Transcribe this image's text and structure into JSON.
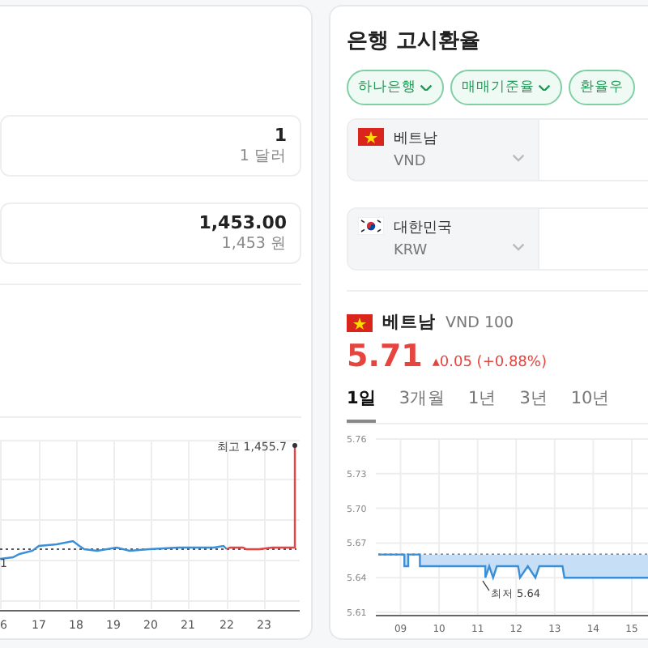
{
  "converter": {
    "rows": [
      {
        "value": "1",
        "unit": "1 달러"
      },
      {
        "value": "1,453.00",
        "unit": "1,453 원"
      }
    ],
    "chart": {
      "high_label": "최고 1,455.7",
      "low_label": "1",
      "x_labels": [
        "6",
        "17",
        "18",
        "19",
        "20",
        "21",
        "22",
        "23"
      ]
    }
  },
  "bank_rates": {
    "title": "은행 고시환율",
    "filters": [
      {
        "label": "하나은행",
        "chevron": true
      },
      {
        "label": "매매기준율",
        "chevron": true
      },
      {
        "label": "환율우",
        "chevron": false
      }
    ],
    "currencies": [
      {
        "kind": "vietnam",
        "country": "베트남",
        "code": "VND"
      },
      {
        "kind": "korea",
        "country": "대한민국",
        "code": "KRW"
      }
    ],
    "quote": {
      "country": "베트남",
      "unit": "VND 100",
      "price": "5.71",
      "change": "▴0.05 (+0.88%)"
    },
    "periods": [
      {
        "label": "1일",
        "selected": true
      },
      {
        "label": "3개월",
        "selected": false
      },
      {
        "label": "1년",
        "selected": false
      },
      {
        "label": "3년",
        "selected": false
      },
      {
        "label": "10년",
        "selected": false
      }
    ],
    "chart_data": {
      "type": "line",
      "grid": true,
      "xlim": [
        8.4,
        15.8
      ],
      "ylim": [
        5.61,
        5.76
      ],
      "xticks": [
        {
          "value": 9,
          "label": "09"
        },
        {
          "value": 10,
          "label": "10"
        },
        {
          "value": 11,
          "label": "11"
        },
        {
          "value": 12,
          "label": "12"
        },
        {
          "value": 13,
          "label": "13"
        },
        {
          "value": 14,
          "label": "14"
        },
        {
          "value": 15,
          "label": "15"
        }
      ],
      "yticks": [
        5.61,
        5.64,
        {
          "value": 5.67,
          "label": "5.67"
        },
        {
          "value": 5.7,
          "label": "5.70"
        },
        5.73,
        5.76
      ],
      "x": [
        8.42,
        9.1,
        9.1,
        9.2,
        9.2,
        9.5,
        9.5,
        11.2,
        11.2,
        11.3,
        11.4,
        11.5,
        12.05,
        12.1,
        12.3,
        12.5,
        12.6,
        13.2,
        13.25,
        15.8
      ],
      "series": [
        {
          "line_style": "dotted",
          "color": "#56708c",
          "values": [
            5.66,
            5.66,
            5.66,
            5.66,
            5.66,
            5.66,
            5.66,
            5.66,
            5.66,
            5.66,
            5.66,
            5.66,
            5.66,
            5.66,
            5.66,
            5.66,
            5.66,
            5.66,
            5.66,
            5.66
          ]
        },
        {
          "line_style": "solid",
          "color": "#3b8fd9",
          "values": [
            5.66,
            5.66,
            5.65,
            5.65,
            5.66,
            5.66,
            5.65,
            5.65,
            5.64,
            5.65,
            5.64,
            5.65,
            5.65,
            5.64,
            5.65,
            5.64,
            5.65,
            5.65,
            5.64,
            5.64
          ]
        }
      ],
      "annotations": [
        {
          "text": "최저 5.64",
          "x": 11.3,
          "y": 5.64
        }
      ]
    }
  }
}
